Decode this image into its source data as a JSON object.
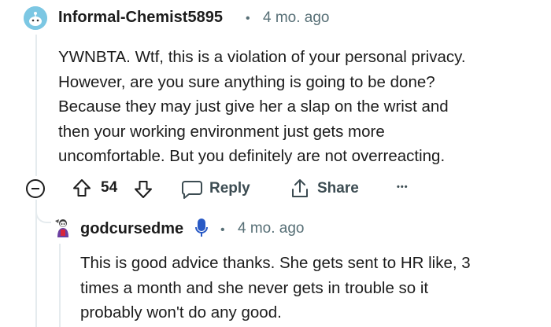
{
  "comment": {
    "author": "Informal-Chemist5895",
    "separator": "•",
    "time": "4 mo. ago",
    "lines": [
      "YWNBTA. Wtf, this is a violation of your personal privacy.",
      "However, are you sure anything is going to be done?",
      "Because they may just give her a slap on the wrist and",
      "then your working environment just gets more",
      "uncomfortable. But you definitely are not overreacting."
    ],
    "votes": "54",
    "reply_label": "Reply",
    "share_label": "Share",
    "more_label": "•••"
  },
  "reply": {
    "author": "godcursedme",
    "separator": "•",
    "time": "4 mo. ago",
    "lines": [
      "This is good advice thanks. She gets sent to HR like, 3",
      "times a month and she never gets in trouble so it",
      "probably won't do any good."
    ]
  },
  "colors": {
    "avatar_bg": "#7cc7e3",
    "mic_blue": "#2859c5",
    "thread_line": "#e5ebee",
    "meta_gray": "#576f76"
  }
}
